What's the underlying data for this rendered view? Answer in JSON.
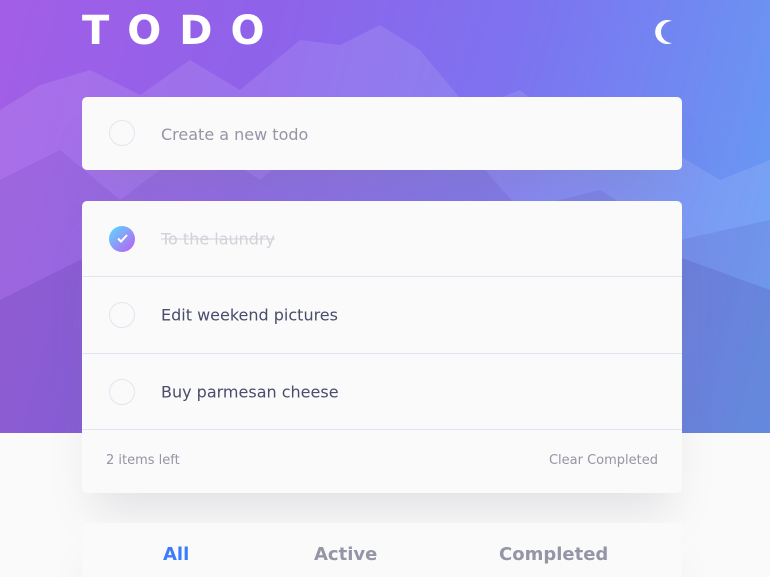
{
  "app": {
    "title": "TODO",
    "theme_icon": "moon-icon"
  },
  "create": {
    "placeholder": "Create a new todo",
    "value": ""
  },
  "todos": [
    {
      "text": "To the laundry",
      "completed": true
    },
    {
      "text": "Edit weekend pictures",
      "completed": false
    },
    {
      "text": "Buy parmesan cheese",
      "completed": false
    }
  ],
  "footer": {
    "items_left": "2 items left",
    "clear_label": "Clear Completed"
  },
  "filters": {
    "all": "All",
    "active": "Active",
    "completed": "Completed",
    "selected": "All"
  },
  "colors": {
    "accent": "#3a7cfd",
    "check_gradient_start": "#57ddff",
    "check_gradient_end": "#c058f3",
    "hero_gradient_start": "#a35ee6",
    "hero_gradient_end": "#62a0f5"
  }
}
